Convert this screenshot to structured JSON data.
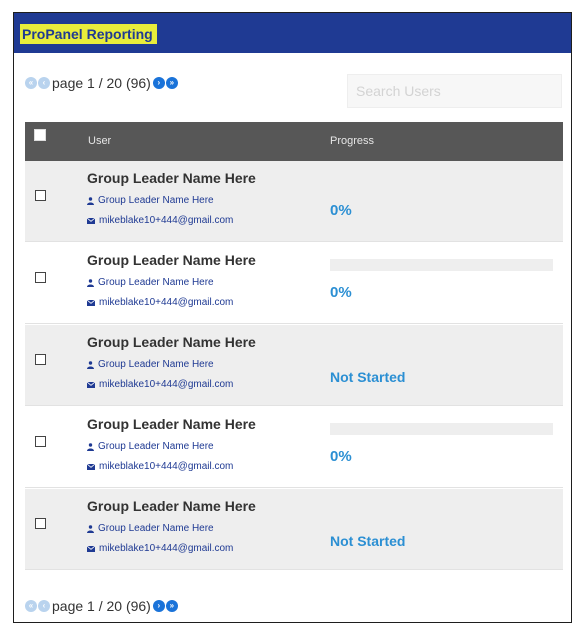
{
  "header": {
    "title": "ProPanel Reporting"
  },
  "pager_top": {
    "text": "page 1 / 20 (96)"
  },
  "pager_bottom": {
    "text": "page 1 / 20 (96)"
  },
  "search": {
    "placeholder": "Search Users"
  },
  "table": {
    "col_user": "User",
    "col_progress": "Progress",
    "rows": [
      {
        "name": "Group Leader Name Here",
        "leader": "Group Leader Name Here",
        "email": "mikeblake10+444@gmail.com",
        "status": "0%",
        "progress_bar": false
      },
      {
        "name": "Group Leader Name Here",
        "leader": "Group Leader Name Here",
        "email": "mikeblake10+444@gmail.com",
        "status": "0%",
        "progress_bar": true,
        "progress": 0
      },
      {
        "name": "Group Leader Name Here",
        "leader": "Group Leader Name Here",
        "email": "mikeblake10+444@gmail.com",
        "status": "Not Started",
        "progress_bar": false
      },
      {
        "name": "Group Leader Name Here",
        "leader": "Group Leader Name Here",
        "email": "mikeblake10+444@gmail.com",
        "status": "0%",
        "progress_bar": true,
        "progress": 0
      },
      {
        "name": "Group Leader Name Here",
        "leader": "Group Leader Name Here",
        "email": "mikeblake10+444@gmail.com",
        "status": "Not Started",
        "progress_bar": false
      }
    ]
  },
  "icons": {
    "first": "first-page-icon",
    "prev": "prev-page-icon",
    "next": "next-page-icon",
    "last": "last-page-icon",
    "user": "user-icon",
    "mail": "mail-icon"
  },
  "colors": {
    "header_bg": "#1f3a93",
    "title_highlight": "#e8ed3b",
    "accent": "#1a73d9",
    "status_text": "#2b8fd3",
    "table_header_bg": "#575757"
  }
}
